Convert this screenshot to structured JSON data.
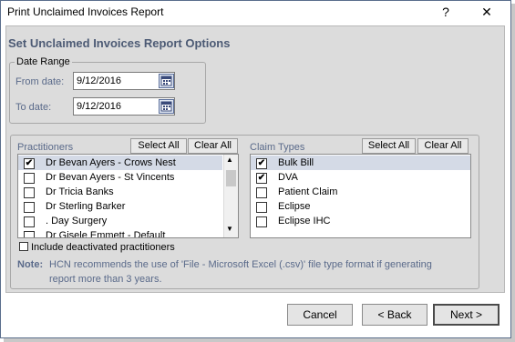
{
  "window": {
    "title": "Print Unclaimed Invoices Report",
    "help_glyph": "?",
    "close_glyph": "✕"
  },
  "heading": "Set Unclaimed Invoices Report Options",
  "date_range": {
    "legend": "Date Range",
    "from_label": "From date:",
    "from_value": "9/12/2016",
    "to_label": "To date:",
    "to_value": "9/12/2016"
  },
  "practitioners": {
    "label": "Practitioners",
    "select_all": "Select All",
    "clear_all": "Clear All",
    "items": [
      {
        "label": "Dr Bevan Ayers - Crows Nest",
        "checked": true,
        "mark": "✔"
      },
      {
        "label": "Dr Bevan Ayers - St Vincents",
        "checked": false,
        "mark": ""
      },
      {
        "label": "Dr Tricia Banks",
        "checked": false,
        "mark": ""
      },
      {
        "label": "Dr Sterling Barker",
        "checked": false,
        "mark": ""
      },
      {
        "label": ". Day Surgery",
        "checked": false,
        "mark": ""
      },
      {
        "label": "Dr Gisele Emmett - Default",
        "checked": false,
        "mark": ""
      }
    ]
  },
  "claim_types": {
    "label": "Claim Types",
    "select_all": "Select All",
    "clear_all": "Clear All",
    "items": [
      {
        "label": "Bulk Bill",
        "checked": true,
        "mark": "✔"
      },
      {
        "label": "DVA",
        "checked": true,
        "mark": "✔"
      },
      {
        "label": "Patient Claim",
        "checked": false,
        "mark": ""
      },
      {
        "label": "Eclipse",
        "checked": false,
        "mark": ""
      },
      {
        "label": "Eclipse IHC",
        "checked": false,
        "mark": ""
      }
    ]
  },
  "include_deactivated": {
    "label": "Include deactivated practitioners",
    "checked": false
  },
  "note": {
    "prefix": "Note:",
    "line1": "HCN recommends the use of 'File - Microsoft Excel (.csv)' file type format if generating",
    "line2": "report more than 3 years."
  },
  "buttons": {
    "cancel": "Cancel",
    "back": "< Back",
    "next": "Next >"
  },
  "colors": {
    "heading": "#4c5a74",
    "panel": "#dcdcdc",
    "selected_row": "#d4dae6"
  }
}
